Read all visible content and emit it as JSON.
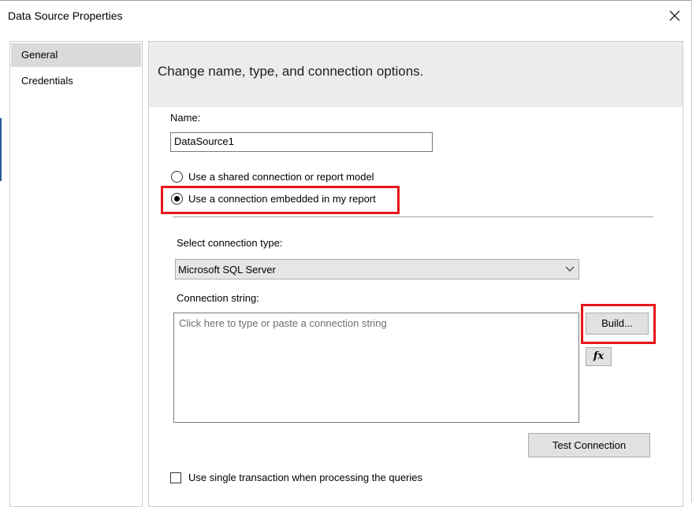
{
  "window": {
    "title": "Data Source Properties",
    "close_icon": "close-icon"
  },
  "nav": {
    "items": [
      {
        "label": "General",
        "selected": true
      },
      {
        "label": "Credentials",
        "selected": false
      }
    ]
  },
  "header": {
    "text": "Change name, type, and connection options."
  },
  "form": {
    "name_label": "Name:",
    "name_value": "DataSource1",
    "radio_shared": {
      "label": "Use a shared connection or report model",
      "checked": false
    },
    "radio_embedded": {
      "label": "Use a connection embedded in my report",
      "checked": true
    },
    "connection_type_label": "Select connection type:",
    "connection_type_value": "Microsoft SQL Server",
    "connection_string_label": "Connection string:",
    "connection_string_placeholder": "Click here to type or paste a connection string",
    "build_button": "Build...",
    "expression_button": "fx",
    "test_connection_button": "Test Connection",
    "single_transaction": {
      "label": "Use single transaction when processing the queries",
      "checked": false
    }
  },
  "colors": {
    "highlight": "#e8141c",
    "header_band": "#ececec",
    "selected_nav": "#dadada"
  }
}
